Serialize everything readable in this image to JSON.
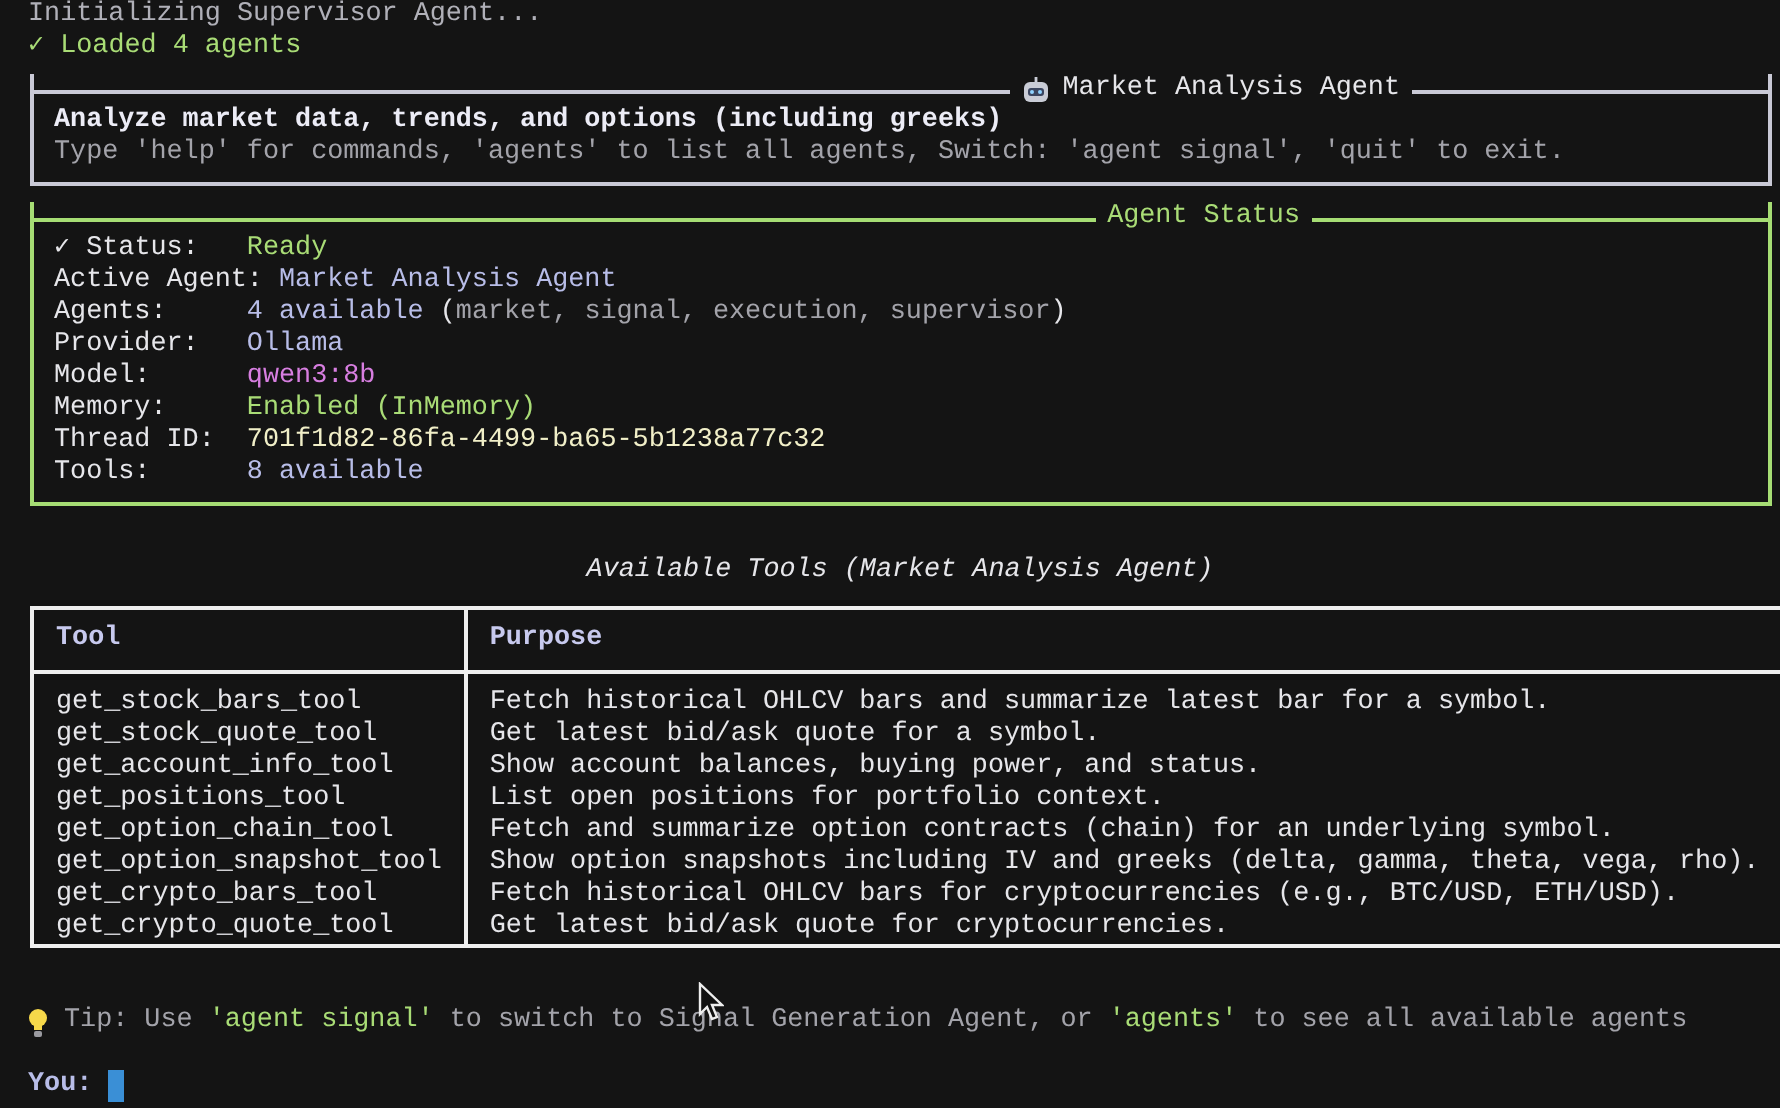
{
  "log_lines": [
    {
      "text": "Initializing Supervisor Agent...",
      "kind": "info"
    },
    {
      "text": "✓ Loaded 4 agents",
      "kind": "success"
    }
  ],
  "agent_panel": {
    "title": "Market Analysis Agent",
    "description": "Analyze market data, trends, and options (including greeks)",
    "help": "Type 'help' for commands, 'agents' to list all agents, Switch: 'agent signal', 'quit' to exit."
  },
  "status_panel": {
    "title": "Agent Status",
    "rows": [
      {
        "label": "✓ Status:",
        "segments": [
          {
            "text": "Ready",
            "color": "#a9dc76"
          }
        ]
      },
      {
        "label": "Active Agent:",
        "segments": [
          {
            "text": "Market Analysis Agent",
            "color": "#b8bde8"
          }
        ]
      },
      {
        "label": "Agents:",
        "segments": [
          {
            "text": "4 available",
            "color": "#b8bde8"
          },
          {
            "text": " (",
            "color": "#e6e6ea"
          },
          {
            "text": "market, signal, execution, supervisor",
            "color": "#a3a3aa"
          },
          {
            "text": ")",
            "color": "#e6e6ea"
          }
        ]
      },
      {
        "label": "Provider:",
        "segments": [
          {
            "text": "Ollama",
            "color": "#b8bde8"
          }
        ]
      },
      {
        "label": "Model:",
        "segments": [
          {
            "text": "qwen3:8b",
            "color": "#d77ee0"
          }
        ]
      },
      {
        "label": "Memory:",
        "segments": [
          {
            "text": "Enabled (InMemory)",
            "color": "#a9dc76"
          }
        ]
      },
      {
        "label": "Thread ID:",
        "segments": [
          {
            "text": "701f1d82-86fa-4499-ba65-5b1238a77c32",
            "color": "#f1efc8"
          }
        ]
      },
      {
        "label": "Tools:",
        "segments": [
          {
            "text": "8 available",
            "color": "#b8bde8"
          }
        ]
      }
    ]
  },
  "tools_table": {
    "title": "Available Tools (Market Analysis Agent)",
    "columns": [
      "Tool",
      "Purpose"
    ],
    "rows": [
      [
        "get_stock_bars_tool",
        "Fetch historical OHLCV bars and summarize latest bar for a symbol."
      ],
      [
        "get_stock_quote_tool",
        "Get latest bid/ask quote for a symbol."
      ],
      [
        "get_account_info_tool",
        "Show account balances, buying power, and status."
      ],
      [
        "get_positions_tool",
        "List open positions for portfolio context."
      ],
      [
        "get_option_chain_tool",
        "Fetch and summarize option contracts (chain) for an underlying symbol."
      ],
      [
        "get_option_snapshot_tool",
        "Show option snapshots including IV and greeks (delta, gamma, theta, vega, rho)."
      ],
      [
        "get_crypto_bars_tool",
        "Fetch historical OHLCV bars for cryptocurrencies (e.g., BTC/USD, ETH/USD)."
      ],
      [
        "get_crypto_quote_tool",
        "Get latest bid/ask quote for cryptocurrencies."
      ]
    ]
  },
  "tip": {
    "segments": [
      {
        "text": "Tip: Use ",
        "color": "#a3a3aa"
      },
      {
        "text": "'agent signal'",
        "color": "#a9dc76"
      },
      {
        "text": " to switch to Signal Generation Agent, or ",
        "color": "#a3a3aa"
      },
      {
        "text": "'agents'",
        "color": "#a9dc76"
      },
      {
        "text": " to see all available agents",
        "color": "#a3a3aa"
      }
    ]
  },
  "prompt": {
    "label": "You:"
  }
}
